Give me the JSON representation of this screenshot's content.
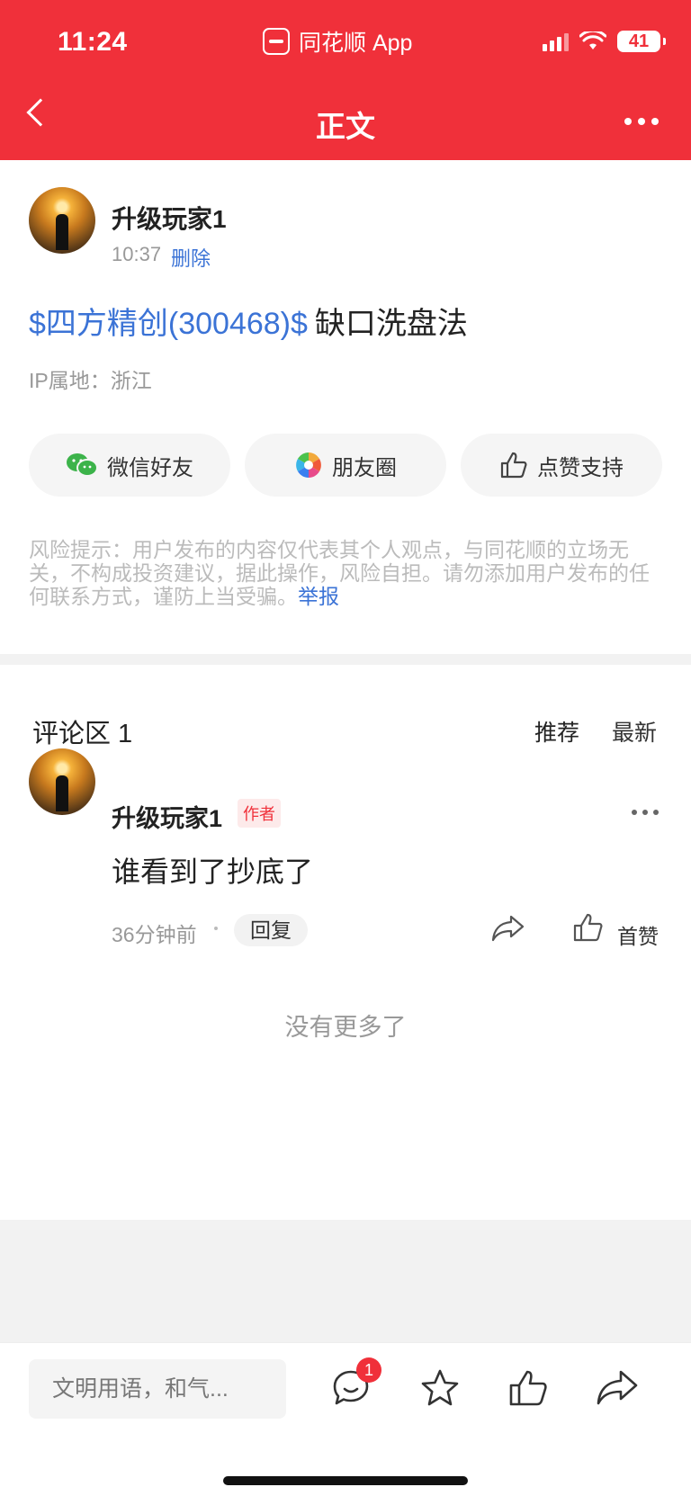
{
  "status_bar": {
    "time": "11:24",
    "app_name": "同花顺 App",
    "battery": "41"
  },
  "nav": {
    "title": "正文",
    "back_icon": "chevron-left-icon",
    "more_icon": "more-dots-icon"
  },
  "post": {
    "author": "升级玩家1",
    "time": "10:37",
    "delete_label": "删除",
    "stock_tag": "$四方精创(300468)$",
    "title_text": "缺口洗盘法",
    "ip_location": "IP属地：浙江"
  },
  "share": {
    "wechat": "微信好友",
    "moments": "朋友圈",
    "like": "点赞支持"
  },
  "risk": {
    "text": "风险提示：用户发布的内容仅代表其个人观点，与同花顺的立场无关，不构成投资建议，据此操作，风险自担。请勿添加用户发布的任何联系方式，谨防上当受骗。",
    "report_label": "举报"
  },
  "comments": {
    "title": "评论区 1",
    "sort_recommend": "推荐",
    "sort_newest": "最新",
    "items": [
      {
        "author": "升级玩家1",
        "badge": "作者",
        "text": "谁看到了抄底了",
        "time": "36分钟前",
        "reply_label": "回复",
        "like_label": "首赞"
      }
    ],
    "no_more": "没有更多了"
  },
  "bottom_bar": {
    "input_placeholder": "文明用语，和气...",
    "comment_badge": "1"
  },
  "colors": {
    "brand_red": "#f0303a",
    "link_blue": "#3b73d6"
  }
}
